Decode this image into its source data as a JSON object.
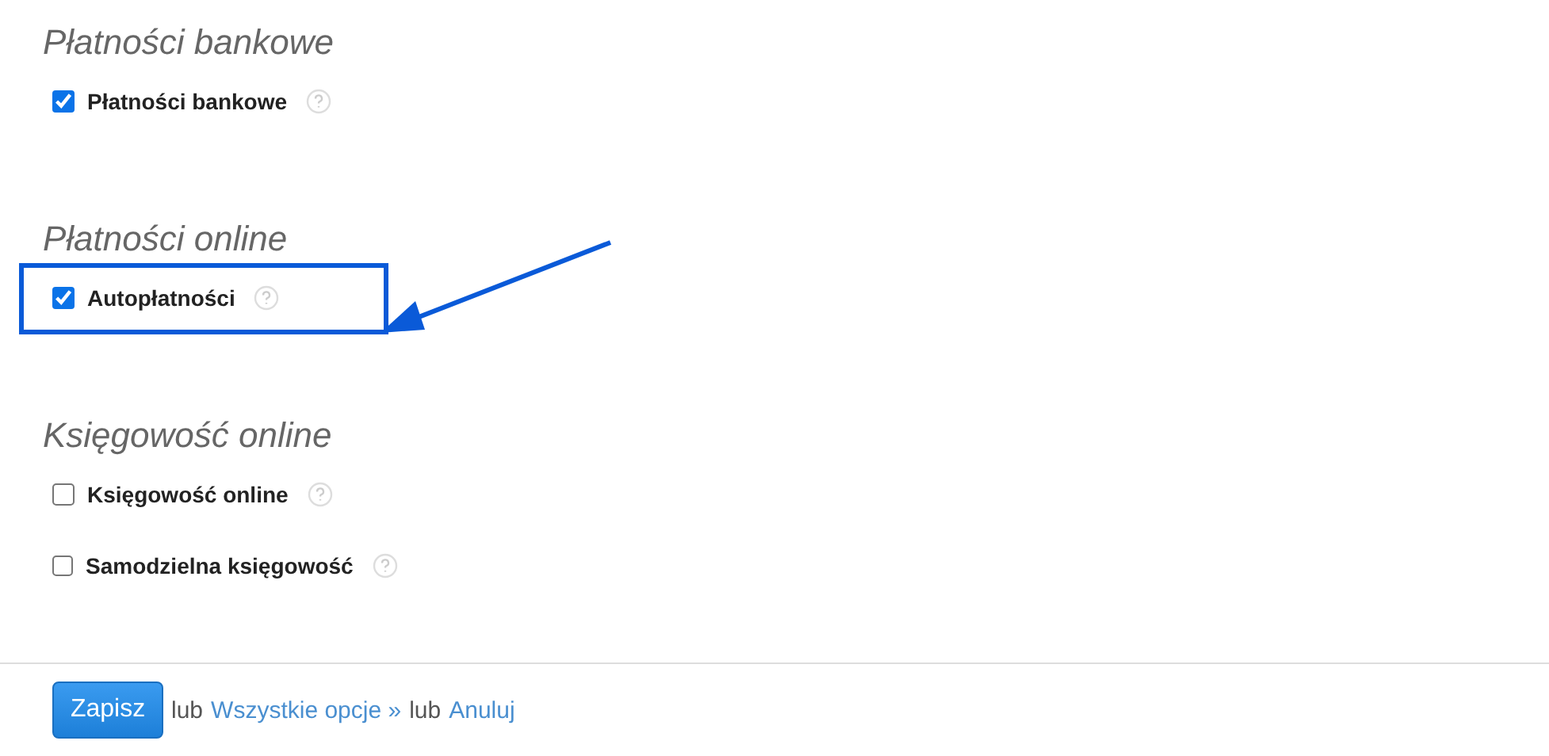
{
  "sections": [
    {
      "heading": "Płatności bankowe",
      "items": [
        {
          "label": "Płatności bankowe",
          "checked": true,
          "highlighted": false
        }
      ]
    },
    {
      "heading": "Płatności online",
      "items": [
        {
          "label": "Autopłatności",
          "checked": true,
          "highlighted": true
        }
      ]
    },
    {
      "heading": "Księgowość online",
      "items": [
        {
          "label": "Księgowość online",
          "checked": false,
          "highlighted": false
        },
        {
          "label": "Samodzielna księgowość",
          "checked": false,
          "highlighted": false
        }
      ]
    }
  ],
  "footer": {
    "save": "Zapisz",
    "or_1": "lub",
    "all_options": "Wszystkie opcje »",
    "or_2": "lub",
    "cancel": "Anuluj"
  }
}
